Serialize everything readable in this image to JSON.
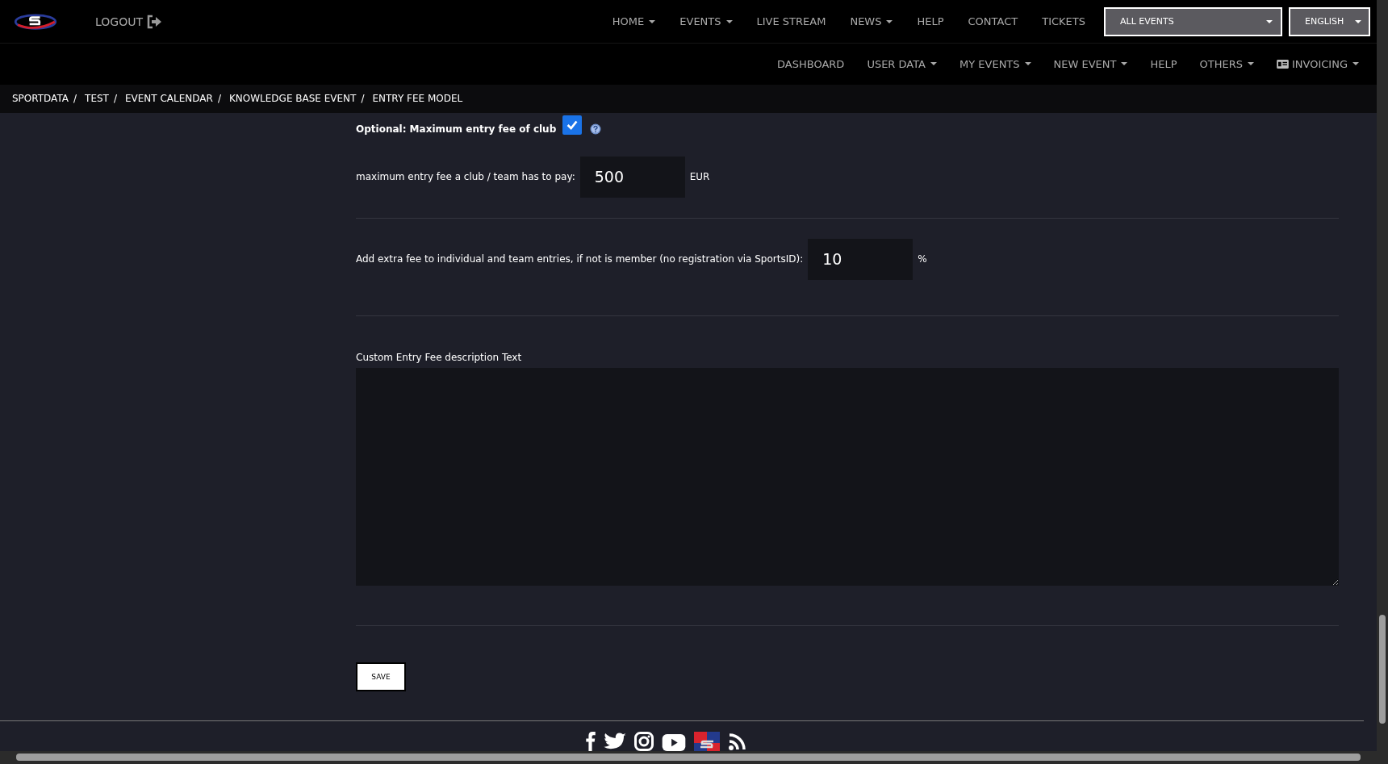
{
  "header": {
    "logout": "LOGOUT",
    "top_nav": [
      {
        "label": "HOME",
        "caret": true
      },
      {
        "label": "EVENTS",
        "caret": true
      },
      {
        "label": "LIVE STREAM",
        "caret": false
      },
      {
        "label": "NEWS",
        "caret": true
      },
      {
        "label": "HELP",
        "caret": false
      },
      {
        "label": "CONTACT",
        "caret": false
      },
      {
        "label": "TICKETS",
        "caret": false
      }
    ],
    "event_select": {
      "value": "ALL EVENTS"
    },
    "language_select": {
      "value": "ENGLISH"
    },
    "sub_nav": [
      {
        "label": "DASHBOARD",
        "caret": false,
        "icon": false
      },
      {
        "label": "USER DATA",
        "caret": true,
        "icon": false
      },
      {
        "label": "MY EVENTS",
        "caret": true,
        "icon": false
      },
      {
        "label": "NEW EVENT",
        "caret": true,
        "icon": false
      },
      {
        "label": "HELP",
        "caret": false,
        "icon": false
      },
      {
        "label": "OTHERS",
        "caret": true,
        "icon": false
      },
      {
        "label": "INVOICING",
        "caret": true,
        "icon": true
      }
    ]
  },
  "breadcrumb": [
    {
      "label": "SPORTDATA",
      "separator": "/"
    },
    {
      "label": "TEST",
      "separator": "/"
    },
    {
      "label": "EVENT CALENDAR",
      "separator": "/"
    },
    {
      "label": "KNOWLEDGE BASE EVENT",
      "separator": "/"
    },
    {
      "label": "ENTRY FEE MODEL"
    }
  ],
  "form": {
    "max_fee_option": {
      "label": "Optional: Maximum entry fee of club",
      "checked": true
    },
    "max_fee": {
      "label": "maximum entry fee a club / team has to pay:",
      "value": "500",
      "unit": "EUR"
    },
    "extra_fee": {
      "label": "Add extra fee to individual and team entries, if not is member (no registration via SportsID):",
      "value": "10",
      "unit": "%"
    },
    "description": {
      "label": "Custom Entry Fee description Text"
    },
    "save": "SAVE"
  }
}
